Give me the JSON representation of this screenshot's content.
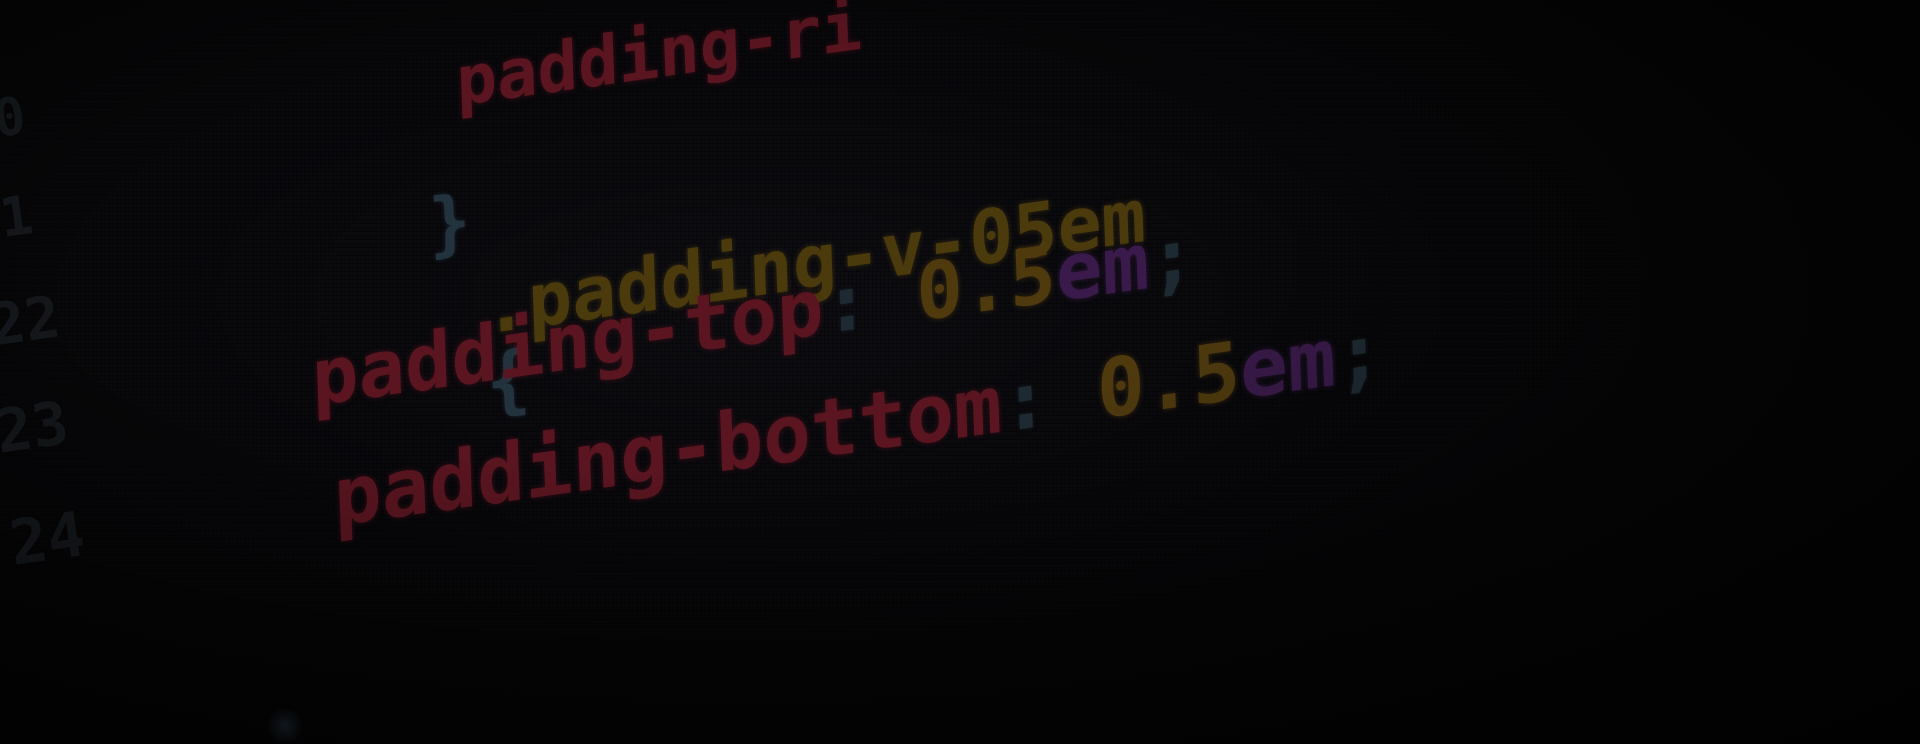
{
  "code_lines": [
    {
      "property": "padding-ri",
      "separator": "",
      "number": "",
      "unit": "",
      "terminator": ""
    },
    {
      "brace": "}"
    },
    {
      "selector": ".padding-v-05em",
      "open_brace": "{"
    },
    {
      "property": "padding-top",
      "separator": ":",
      "number": "0.5",
      "unit": "em",
      "terminator": ";"
    },
    {
      "property": "padding-bottom",
      "separator": ":",
      "number": "0.5",
      "unit": "em",
      "terminator": ";"
    }
  ],
  "line_numbers": [
    "0",
    "1",
    "22",
    "23",
    "24"
  ],
  "colors": {
    "property": "#5a1520",
    "selector": "#4a3a0c",
    "number": "#4f3a0e",
    "unit": "#3a1a4a",
    "punctuation": "#1e2a32",
    "background": "#050507"
  }
}
